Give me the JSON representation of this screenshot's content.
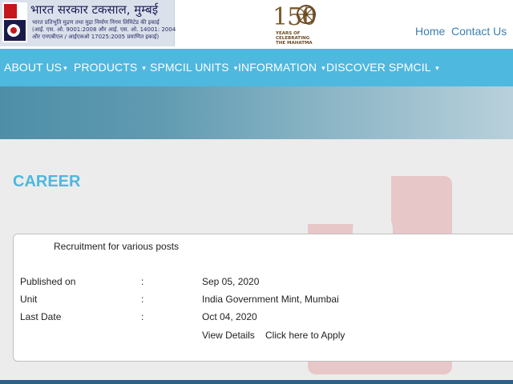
{
  "header": {
    "logo_title": "भारत सरकार टकसाल, मुम्बई",
    "logo_lines": [
      "भारत प्रतिभूति मुद्रण तथा मुद्रा निर्माण निगम लिमिटेड की इकाई",
      "(आई. एस. ओ. 9001:2008 और आई. एस. ओ. 14001: 2004",
      "और एनएबीएल / आईएसओ 17025:2005 प्रमाणित इकाई)"
    ],
    "emblem_number": "150",
    "emblem_lines": [
      "YEARS OF",
      "CELEBRATING",
      "THE MAHATMA"
    ],
    "links": {
      "home": "Home",
      "contact": "Contact Us"
    }
  },
  "nav": {
    "items": [
      {
        "label": "ABOUT US"
      },
      {
        "label": "PRODUCTS"
      },
      {
        "label": "SPMCIL UNITS"
      },
      {
        "label": "INFORMATION"
      },
      {
        "label": "DISCOVER SPMCIL"
      }
    ],
    "caret": "▾"
  },
  "main": {
    "section_title": "CAREER",
    "card": {
      "heading": "Recruitment for various posts",
      "rows": [
        {
          "label": "Published on",
          "colon": ":",
          "value": "Sep 05, 2020"
        },
        {
          "label": "Unit",
          "colon": ":",
          "value": "India Government Mint, Mumbai"
        },
        {
          "label": "Last Date",
          "colon": ":",
          "value": "Oct 04, 2020"
        }
      ],
      "view_details": "View Details",
      "apply": "Click here to Apply"
    }
  },
  "colors": {
    "nav_bg": "#4eb8df",
    "accent": "#4eb8df",
    "link": "#3a7fb0"
  }
}
